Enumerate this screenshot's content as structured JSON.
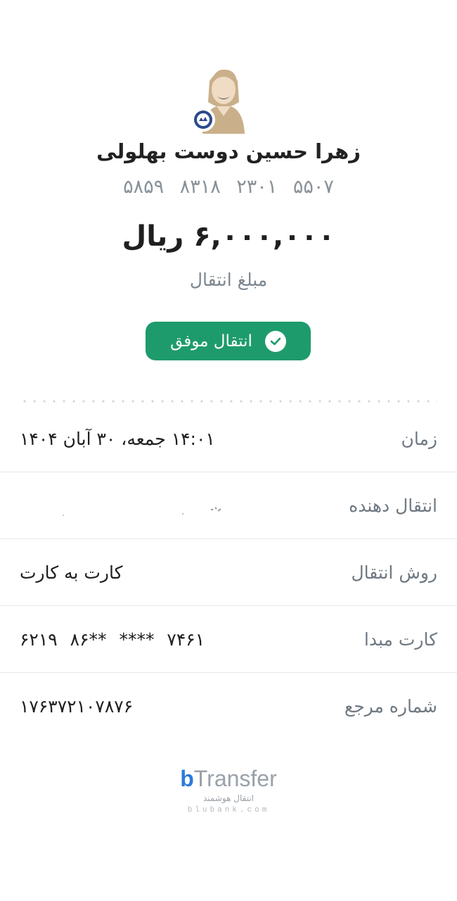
{
  "recipient": {
    "name": "زهرا حسین دوست بهلولی",
    "card_number": "۵۸۵۹ ۸۳۱۸ ۲۳۰۱ ۵۵۰۷"
  },
  "transfer": {
    "amount": "۶,۰۰۰,۰۰۰ ریال",
    "amount_caption": "مبلغ انتقال",
    "status": "انتقال موفق"
  },
  "details": [
    {
      "key": "زمان",
      "value": "۱۴:۰۱ جمعه، ۳۰ آبان ۱۴۰۴"
    },
    {
      "key": "انتقال دهنده",
      "value": ""
    },
    {
      "key": "روش انتقال",
      "value": "کارت به کارت"
    },
    {
      "key": "کارت مبدا",
      "value": "۶۲۱۹ ۸۶** **** ۷۴۶۱"
    },
    {
      "key": "شماره مرجع",
      "value": "۱۷۶۳۷۲۱۰۷۸۷۶"
    }
  ],
  "footer": {
    "brand_b": "b",
    "brand_rest": "Transfer",
    "tagline": "انتقال هوشمند",
    "domain": "blubank.com"
  },
  "colors": {
    "success": "#1e9b6c",
    "brand_blue": "#2b7bd6"
  }
}
